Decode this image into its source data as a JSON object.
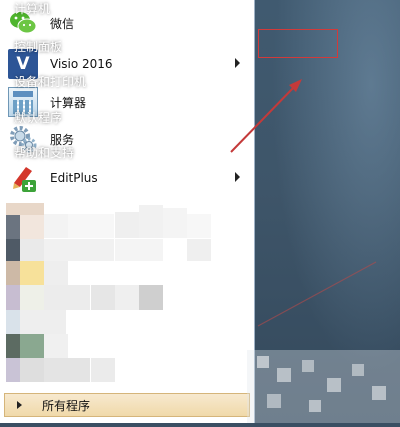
{
  "start_menu": {
    "programs": [
      {
        "label": "微信",
        "icon": "wechat-icon",
        "has_submenu": false
      },
      {
        "label": "Visio 2016",
        "icon": "visio-icon",
        "icon_text": "V",
        "has_submenu": true
      },
      {
        "label": "计算器",
        "icon": "calculator-icon",
        "has_submenu": false
      },
      {
        "label": "服务",
        "icon": "gear-icon",
        "has_submenu": false
      },
      {
        "label": "EditPlus",
        "icon": "editplus-icon",
        "has_submenu": true
      }
    ],
    "all_programs_label": "所有程序"
  },
  "right_panel": {
    "items": [
      {
        "label": "计算机"
      },
      {
        "label": "控制面板",
        "highlighted": true
      },
      {
        "label": "设备和打印机"
      },
      {
        "label": "默认程序"
      },
      {
        "label": "帮助和支持"
      }
    ]
  },
  "colors": {
    "highlight": "#d23a3a",
    "arrow": "#c43a3a",
    "right_panel_bg": "#3e5569",
    "all_programs_bg": "#f0d9a9"
  }
}
